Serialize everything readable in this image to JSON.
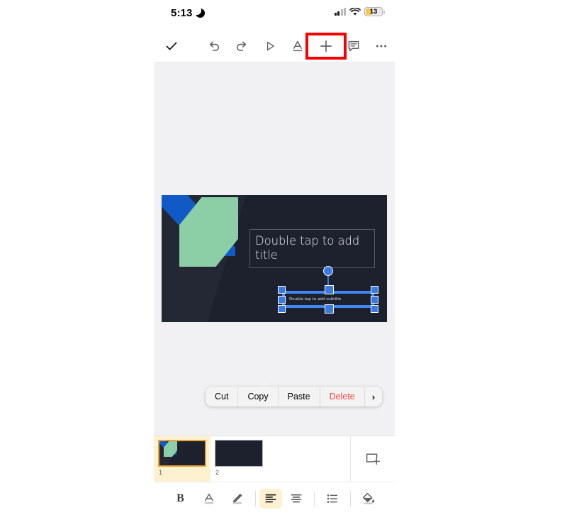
{
  "status_bar": {
    "time": "5:13",
    "moon_icon": "crescent-moon-icon",
    "signal_icon": "cellular-signal-icon",
    "wifi_icon": "wifi-icon",
    "battery_level": "13",
    "battery_color": "#f7c948"
  },
  "top_toolbar": {
    "items": [
      {
        "name": "done-checkmark-button",
        "icon": "checkmark-icon",
        "label": "Done"
      },
      {
        "name": "undo-button",
        "icon": "undo-arrow-icon",
        "label": "Undo"
      },
      {
        "name": "redo-button",
        "icon": "redo-arrow-icon",
        "label": "Redo"
      },
      {
        "name": "present-button",
        "icon": "play-triangle-icon",
        "label": "Present"
      },
      {
        "name": "text-format-button",
        "icon": "underlined-a-icon",
        "label": "Format"
      },
      {
        "name": "insert-button",
        "icon": "plus-icon",
        "label": "Insert"
      },
      {
        "name": "comment-button",
        "icon": "comment-bubble-icon",
        "label": "Comment"
      },
      {
        "name": "more-options-button",
        "icon": "three-dots-icon",
        "label": "More options"
      }
    ],
    "highlight": {
      "target": "insert-button",
      "color": "#f80000"
    }
  },
  "slide": {
    "background_color": "#1d212e",
    "decor": {
      "blue_shape_color": "#1259c8",
      "green_shape_color": "#8ccfa6"
    },
    "title_placeholder": "Double tap to add title",
    "subtitle_placeholder": "Double tap to add subtitle",
    "selection": {
      "handle_color": "#4285f4",
      "rotate_handle": "rotation-handle"
    }
  },
  "context_menu": {
    "items": [
      {
        "label": "Cut",
        "danger": false
      },
      {
        "label": "Copy",
        "danger": false
      },
      {
        "label": "Paste",
        "danger": false
      },
      {
        "label": "Delete",
        "danger": true
      }
    ],
    "more_chevron": "›",
    "danger_color": "#ff4136"
  },
  "filmstrip": {
    "slides": [
      {
        "number": "1",
        "selected": true,
        "has_decor": true
      },
      {
        "number": "2",
        "selected": false,
        "has_decor": false
      }
    ],
    "add_slide_icon": "add-slide-icon",
    "selected_border_color": "#e8a33d",
    "selected_bg_color": "#fdf1cf"
  },
  "bottom_toolbar": {
    "items": [
      {
        "name": "bold-button",
        "icon": "bold-b-icon",
        "label": "B",
        "active": false
      },
      {
        "name": "text-color-button",
        "icon": "underlined-a-icon",
        "label": "Text color",
        "active": false
      },
      {
        "name": "highlight-pen-button",
        "icon": "pen-icon",
        "label": "Highlight",
        "active": false
      },
      {
        "name": "align-left-button",
        "icon": "align-left-icon",
        "label": "Align left",
        "active": true
      },
      {
        "name": "align-center-button",
        "icon": "align-center-icon",
        "label": "Align center",
        "active": false
      },
      {
        "name": "bullet-list-button",
        "icon": "bullet-list-icon",
        "label": "Bulleted list",
        "active": false
      },
      {
        "name": "fill-color-button",
        "icon": "paint-bucket-icon",
        "label": "Fill color",
        "active": false
      }
    ],
    "active_bg_color": "#fdf1cf"
  }
}
